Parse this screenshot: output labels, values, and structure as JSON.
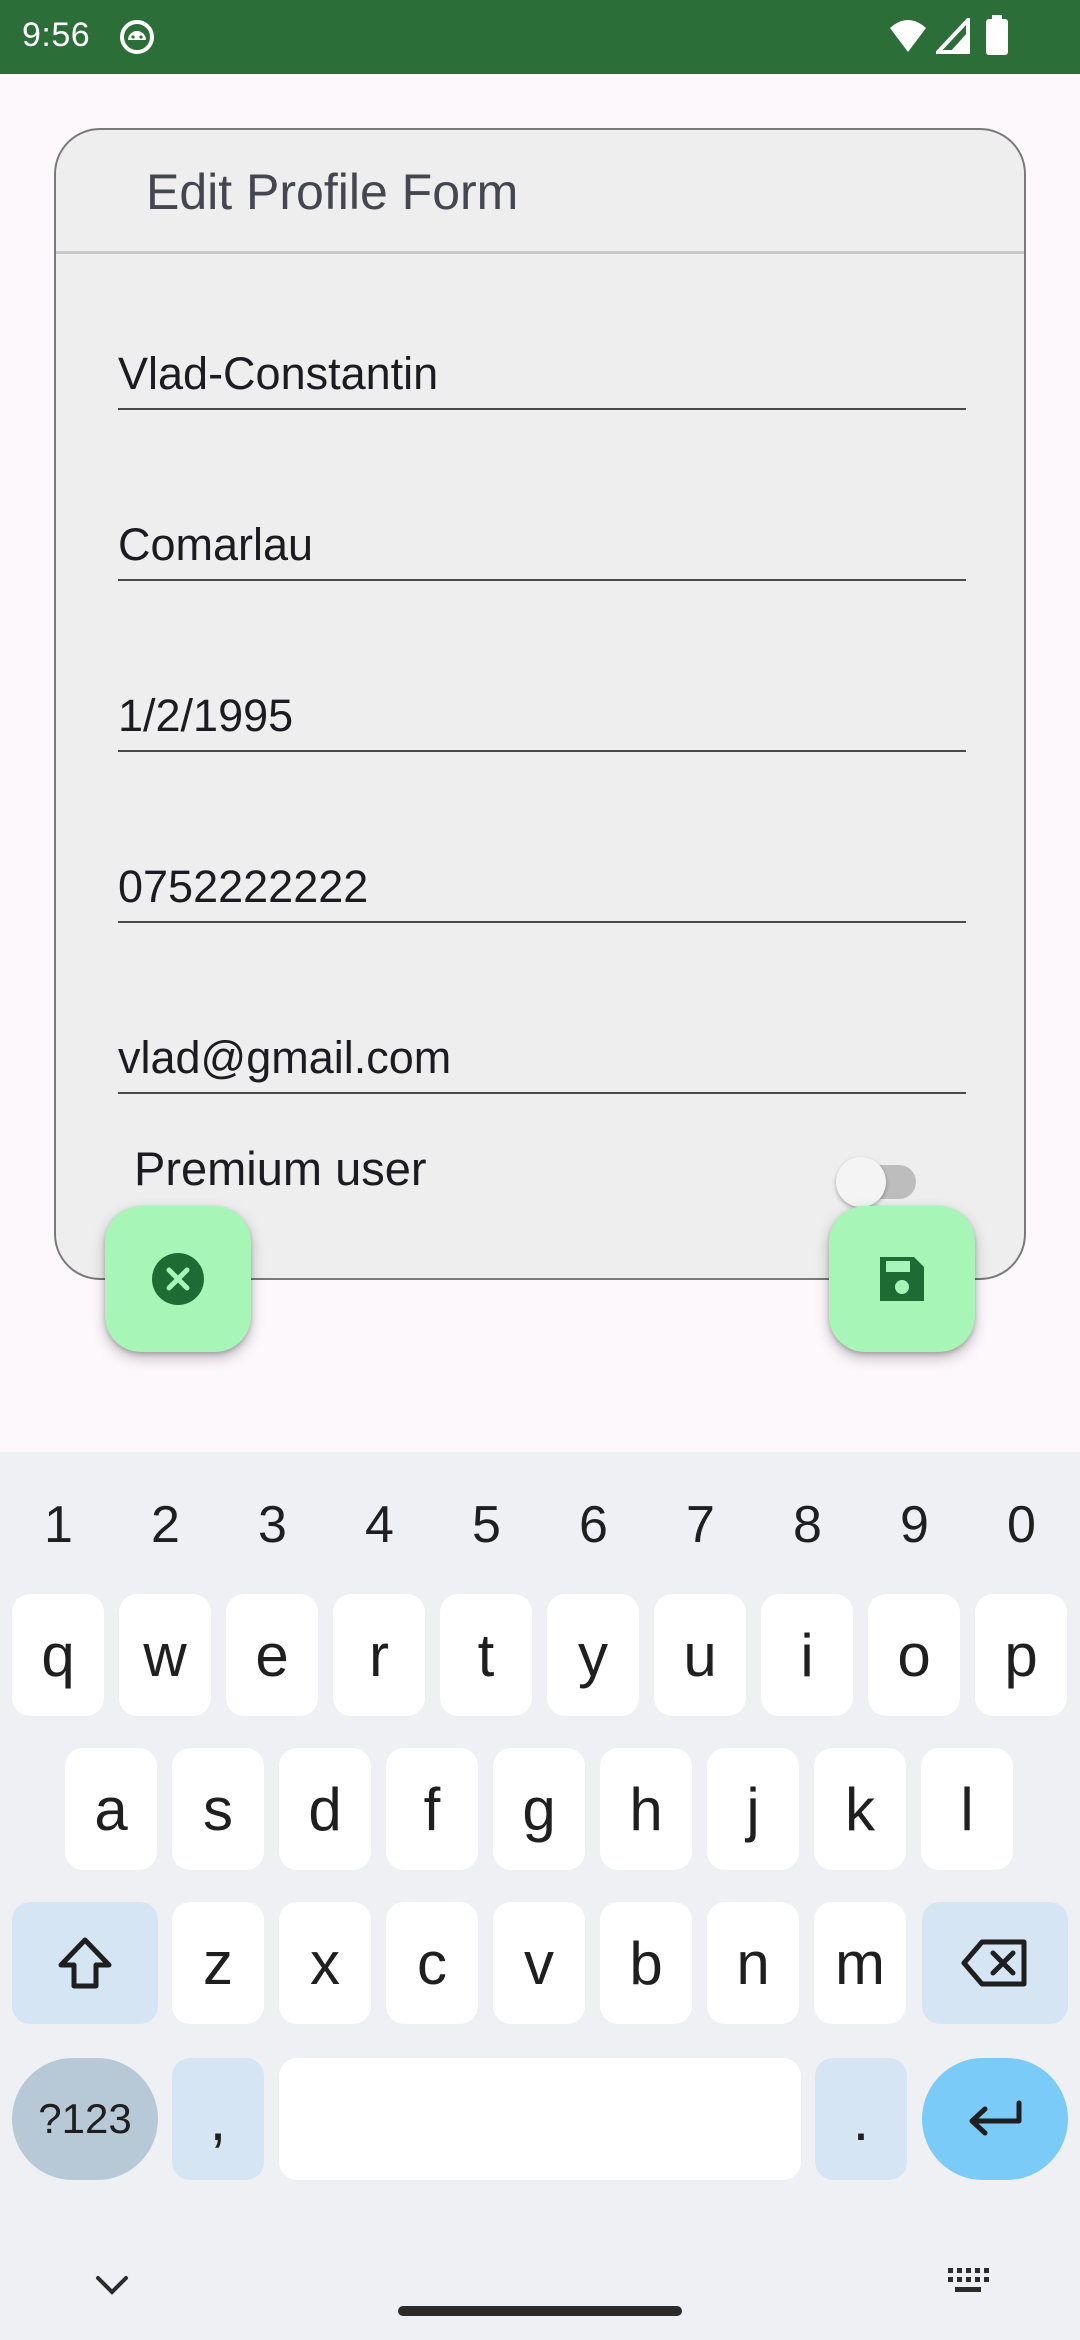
{
  "status_bar": {
    "time": "9:56",
    "background": "#2b6e37",
    "icons": [
      "android-app-icon",
      "wifi-icon",
      "cell-signal-icon",
      "battery-icon"
    ]
  },
  "form": {
    "title": "Edit Profile Form",
    "fields": {
      "first_name": "Vlad-Constantin",
      "last_name": "Comarlau",
      "birth_date": "1/2/1995",
      "phone": "0752222222",
      "email": "vlad@gmail.com"
    },
    "premium_label": "Premium user",
    "premium_enabled": false,
    "cancel_icon": "cancel-icon",
    "save_icon": "save-icon",
    "fab_color": "#a8f5b8",
    "icon_color": "#1e6b33"
  },
  "keyboard": {
    "numbers": [
      "1",
      "2",
      "3",
      "4",
      "5",
      "6",
      "7",
      "8",
      "9",
      "0"
    ],
    "row1": [
      "q",
      "w",
      "e",
      "r",
      "t",
      "y",
      "u",
      "i",
      "o",
      "p"
    ],
    "row2": [
      "a",
      "s",
      "d",
      "f",
      "g",
      "h",
      "j",
      "k",
      "l"
    ],
    "row3": [
      "z",
      "x",
      "c",
      "v",
      "b",
      "n",
      "m"
    ],
    "symbols_label": "?123",
    "comma": ",",
    "period": ".",
    "enter_color": "#7acbf7"
  }
}
